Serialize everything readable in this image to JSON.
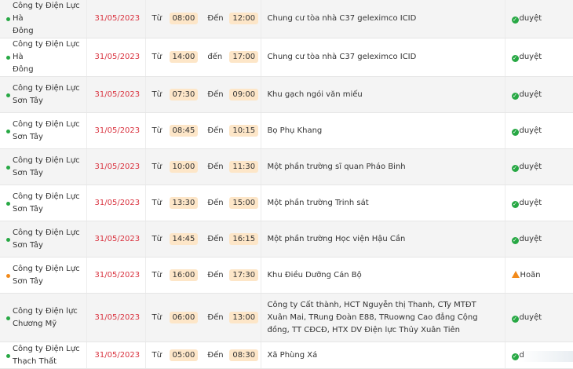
{
  "labels": {
    "from": "Từ",
    "to_upper": "Đến",
    "to_lower": "đến"
  },
  "colors": {
    "date": "#d9333f",
    "status_ok": "#27a844",
    "status_warn": "#f28a1a",
    "time_badge": "#fde6c8"
  },
  "rows": [
    {
      "unit": [
        "Công ty Điện Lực Hà",
        "Đông"
      ],
      "date": "31/05/2023",
      "from_label": "Từ",
      "start": "08:00",
      "to_label": "Đến",
      "end": "12:00",
      "place": "Chung cư tòa nhà C37 geleximco ICID",
      "status": "duyệt",
      "status_icon": "check-circle-icon",
      "dot": "green"
    },
    {
      "unit": [
        "Công ty Điện Lực Hà",
        "Đông"
      ],
      "date": "31/05/2023",
      "from_label": "Từ",
      "start": "14:00",
      "to_label": "đến",
      "end": "17:00",
      "place": "Chung cư tòa nhà C37 geleximco ICID",
      "status": "duyệt",
      "status_icon": "check-circle-icon",
      "dot": "green"
    },
    {
      "unit": [
        "Công ty Điện Lực",
        "Sơn Tây"
      ],
      "date": "31/05/2023",
      "from_label": "Từ",
      "start": "07:30",
      "to_label": "Đến",
      "end": "09:00",
      "place": "Khu gạch ngói văn miếu",
      "status": "duyệt",
      "status_icon": "check-circle-icon",
      "dot": "green"
    },
    {
      "unit": [
        "Công ty Điện Lực",
        "Sơn Tây"
      ],
      "date": "31/05/2023",
      "from_label": "Từ",
      "start": "08:45",
      "to_label": "Đến",
      "end": "10:15",
      "place": "Bọ Phụ Khang",
      "status": "duyệt",
      "status_icon": "check-circle-icon",
      "dot": "green"
    },
    {
      "unit": [
        "Công ty Điện Lực",
        "Sơn Tây"
      ],
      "date": "31/05/2023",
      "from_label": "Từ",
      "start": "10:00",
      "to_label": "Đến",
      "end": "11:30",
      "place": "Một phần trường sĩ quan Pháo Binh",
      "status": "duyệt",
      "status_icon": "check-circle-icon",
      "dot": "green"
    },
    {
      "unit": [
        "Công ty Điện Lực",
        "Sơn Tây"
      ],
      "date": "31/05/2023",
      "from_label": "Từ",
      "start": "13:30",
      "to_label": "Đến",
      "end": "15:00",
      "place": "Một phần trường Trinh sát",
      "status": "duyệt",
      "status_icon": "check-circle-icon",
      "dot": "green"
    },
    {
      "unit": [
        "Công ty Điện Lực",
        "Sơn Tây"
      ],
      "date": "31/05/2023",
      "from_label": "Từ",
      "start": "14:45",
      "to_label": "Đến",
      "end": "16:15",
      "place": "Một phần trường Học viện Hậu Cần",
      "status": "duyệt",
      "status_icon": "check-circle-icon",
      "dot": "green"
    },
    {
      "unit": [
        "Công ty Điện Lực",
        "Sơn Tây"
      ],
      "date": "31/05/2023",
      "from_label": "Từ",
      "start": "16:00",
      "to_label": "Đến",
      "end": "17:30",
      "place": "Khu Điều Dưỡng Cán Bộ",
      "status": "Hoãn",
      "status_icon": "warning-icon",
      "dot": "orange"
    },
    {
      "unit": [
        "Công ty Điện lực",
        "Chương Mỹ"
      ],
      "date": "31/05/2023",
      "from_label": "Từ",
      "start": "06:00",
      "to_label": "Đến",
      "end": "13:00",
      "place": "Công ty Cất thành, HCT Nguyễn thị Thanh, CTy MTĐT Xuân Mai, TRung Đoàn E88, TRuowng Cao đẳng Cộng đồng, TT CĐCĐ, HTX DV Điện lực Thủy Xuân Tiên",
      "status": "duyệt",
      "status_icon": "check-circle-icon",
      "dot": "green"
    },
    {
      "unit": [
        "Công ty Điện Lực",
        "Thạch Thất"
      ],
      "date": "31/05/2023",
      "from_label": "Từ",
      "start": "05:00",
      "to_label": "Đến",
      "end": "08:30",
      "place": "Xã Phùng Xá",
      "status": "d",
      "status_icon": "check-circle-icon",
      "dot": "green"
    }
  ]
}
